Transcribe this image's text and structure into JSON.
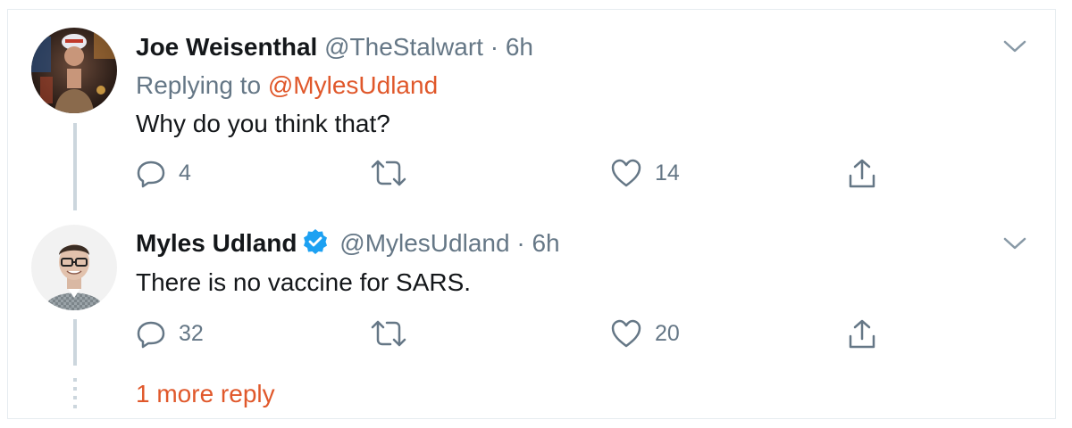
{
  "thread": {
    "tweets": [
      {
        "name": "Joe Weisenthal",
        "handle": "@TheStalwart",
        "separator": "·",
        "time": "6h",
        "replying_prefix": "Replying to",
        "replying_to": "@MylesUdland",
        "text": "Why do you think that?",
        "reply_count": "4",
        "retweet_count": "",
        "like_count": "14",
        "verified": false
      },
      {
        "name": "Myles Udland",
        "handle": "@MylesUdland",
        "separator": "·",
        "time": "6h",
        "text": "There is no vaccine for SARS.",
        "reply_count": "32",
        "retweet_count": "",
        "like_count": "20",
        "verified": true
      }
    ],
    "more_replies": "1 more reply"
  },
  "colors": {
    "accent": "#e0582b",
    "verified": "#1da1f2",
    "muted_text": "#657786",
    "thread_line": "#ccd6dd"
  },
  "icons": [
    "avatar-joe",
    "avatar-myles",
    "verified-badge-icon",
    "chevron-down-icon",
    "reply-icon",
    "retweet-icon",
    "like-icon",
    "share-icon"
  ]
}
